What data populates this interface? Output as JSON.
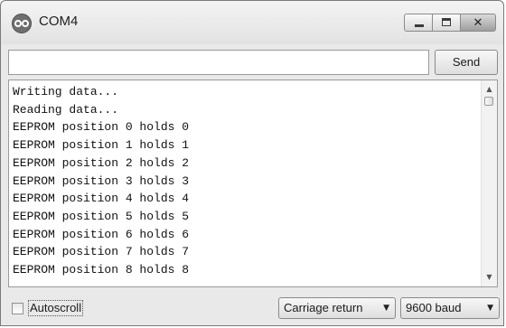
{
  "window": {
    "title": "COM4",
    "app_icon": "arduino-infinity-icon"
  },
  "window_controls": {
    "minimize_icon": "minimize-icon",
    "maximize_icon": "maximize-icon",
    "close_glyph": "✕"
  },
  "send_bar": {
    "input_value": "",
    "send_label": "Send"
  },
  "output": {
    "lines": [
      "Writing data...",
      "Reading data...",
      "EEPROM position 0 holds 0",
      "EEPROM position 1 holds 1",
      "EEPROM position 2 holds 2",
      "EEPROM position 3 holds 3",
      "EEPROM position 4 holds 4",
      "EEPROM position 5 holds 5",
      "EEPROM position 6 holds 6",
      "EEPROM position 7 holds 7",
      "EEPROM position 8 holds 8"
    ]
  },
  "bottom_bar": {
    "autoscroll_label": "Autoscroll",
    "autoscroll_checked": false,
    "line_ending_value": "Carriage return",
    "baud_value": "9600 baud"
  }
}
